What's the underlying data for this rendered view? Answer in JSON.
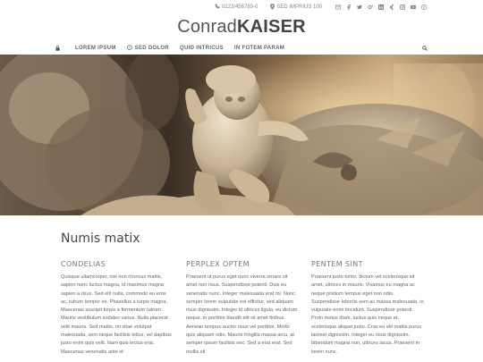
{
  "topbar": {
    "phone": "0123/456789-0",
    "address": "SED IMPRIUS 100",
    "icons": [
      "email-icon",
      "facebook-icon",
      "twitter-icon",
      "google-plus-icon",
      "linkedin-icon",
      "xing-icon",
      "instagram-icon",
      "youtube-icon",
      "pinterest-icon"
    ]
  },
  "logo": {
    "light": "Conrad",
    "bold": "KAISER"
  },
  "nav": {
    "items": [
      {
        "label": "LOREM IPSUM"
      },
      {
        "label": "SED DOLOR"
      },
      {
        "label": "QUID INTRICUS"
      },
      {
        "label": "IN FOTEM PARAM"
      }
    ]
  },
  "hero": {
    "subject": "cherub-sculpture"
  },
  "main": {
    "title": "Numis matix",
    "columns": [
      {
        "heading": "CONDELIAS",
        "text": "Quisque ullamcorper, nisi non rhoncus mattis, sapien nunc luctus magna, id maximus magna sapien a risus. Sed elit nulla, commodo eu eros ac, rutrum tempor ex. Phasellus a turpis magna. Maecenas suscipit turpis a fermentum rutrum. Mauris vestibulum sodales varius. Nulla placerat velit mauris. Sed mattis, mi vitae volutpat malesuada, sem neque facilisis tellus, vel dapibus justo enim quis velit. Nam quis lectus erat. Maecenas venenatis ante id"
      },
      {
        "heading": "PERPLEX OPTEM",
        "text": "Praesent ut purus eget nunc viverra ornare sit amet non risus. Suspendisse potenti. Duis eu venenatis nunc. Integer malesuada erat mi. Nunc semper lorem vulputate est efficitur, sed aliquam risus dignissim. Integer id ultrices ligula, eu dictum neque. In porttitor blandit elit sit amet finibus. Aenean tempus auctor risus vel porttitor. Morbi quis aliquam odio. Mauris fringilla massa arcu, at semper ipsum facilisis nec. Sed a erat erat. Sed mollis sit"
      },
      {
        "heading": "PENTEM SINT",
        "text": "Praesent justo tortor, dictum vel scelerisque sit amet, ultrices in mauris. Vivamus eu magna ac neque pretium tempus eget non odio. Suspendisse lobortis sem ac massa malesuada, in vulputate enim tincidunt. Suspendisse potenti. Proin metus diam, luctus quis neque et, scelerisque aliquet justo. Cras eu elit mattis purus laoreet dignissim. Integer eu risus dignissim, bibendum magna non, ultrices lacus. Praesent in lorem nunc."
      }
    ]
  }
}
